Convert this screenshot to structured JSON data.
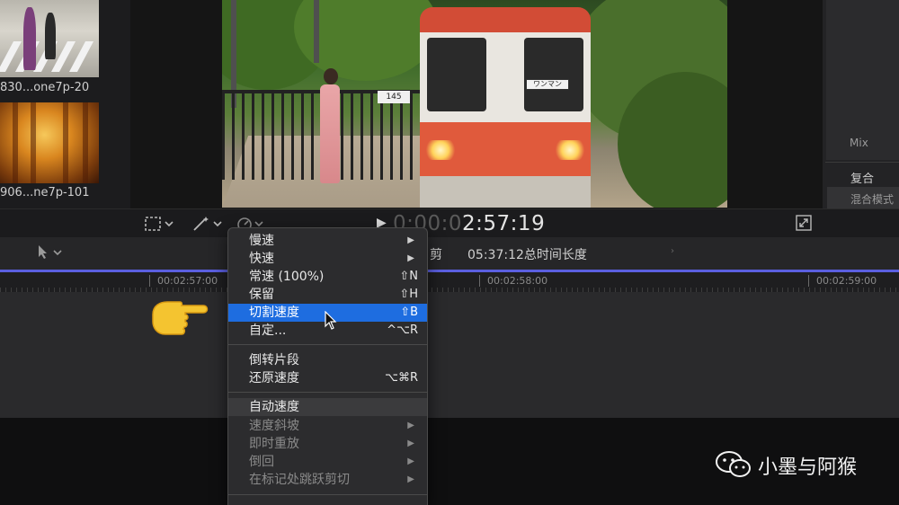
{
  "browser": {
    "clips": [
      {
        "label": "830...one7p-20"
      },
      {
        "label": "906...ne7p-101"
      }
    ]
  },
  "video": {
    "placard": "145",
    "train_sign": "ワンマン"
  },
  "inspector": {
    "mix_label": "Mix",
    "compound_label": "复合",
    "blend_label": "混合模式"
  },
  "viewer_toolbar": {
    "timecode_dim": "0:00:0",
    "timecode_bright": "2:57:19"
  },
  "timeline_toolbar": {
    "clip_name_partial": "剪",
    "duration_text": "05:37:12总时间长度"
  },
  "ruler": {
    "marks": [
      "00:02:57:00",
      "00:02:58:00",
      "00:02:59:00"
    ]
  },
  "menu": {
    "items": [
      {
        "label": "慢速",
        "submenu": true
      },
      {
        "label": "快速",
        "submenu": true
      },
      {
        "label": "常速 (100%)",
        "shortcut": "⇧N"
      },
      {
        "label": "保留",
        "shortcut": "⇧H"
      },
      {
        "label": "切割速度",
        "shortcut": "⇧B",
        "highlighted": true
      },
      {
        "label": "自定...",
        "shortcut": "^⌥R"
      },
      {
        "label": "倒转片段"
      },
      {
        "label": "还原速度",
        "shortcut": "⌥⌘R"
      },
      {
        "label": "自动速度"
      },
      {
        "label": "速度斜坡",
        "submenu": true,
        "disabled": true
      },
      {
        "label": "即时重放",
        "submenu": true,
        "disabled": true
      },
      {
        "label": "倒回",
        "submenu": true,
        "disabled": true
      },
      {
        "label": "在标记处跳跃剪切",
        "submenu": true,
        "disabled": true
      }
    ],
    "arrow_glyph": "▶"
  },
  "watermark": {
    "text": "小墨与阿猴"
  },
  "colors": {
    "menu_highlight": "#1e6de0",
    "timeline_accent": "#5b5fe0"
  }
}
